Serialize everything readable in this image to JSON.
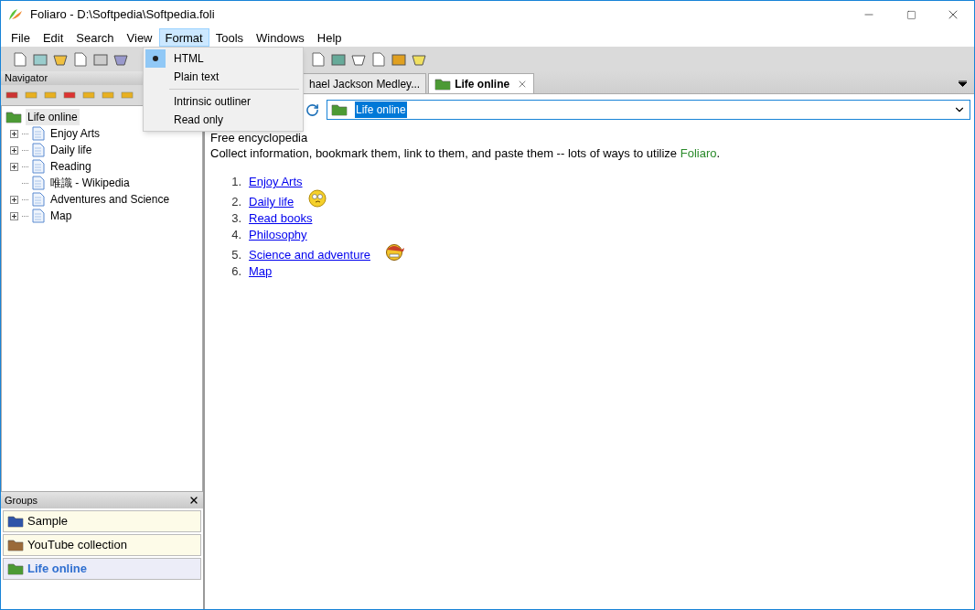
{
  "window": {
    "title": "Foliaro - D:\\Softpedia\\Softpedia.foli"
  },
  "menu_bar": [
    {
      "label": "File",
      "selected": false
    },
    {
      "label": "Edit",
      "selected": false
    },
    {
      "label": "Search",
      "selected": false
    },
    {
      "label": "View",
      "selected": false
    },
    {
      "label": "Format",
      "selected": true
    },
    {
      "label": "Tools",
      "selected": false
    },
    {
      "label": "Windows",
      "selected": false
    },
    {
      "label": "Help",
      "selected": false
    }
  ],
  "format_menu": [
    {
      "kind": "item",
      "label": "HTML",
      "checked": true,
      "selected": true
    },
    {
      "kind": "item",
      "label": "Plain text",
      "checked": false,
      "selected": false
    },
    {
      "kind": "separator"
    },
    {
      "kind": "item",
      "label": "Intrinsic outliner",
      "checked": false,
      "selected": false
    },
    {
      "kind": "item",
      "label": "Read only",
      "checked": false,
      "selected": false
    }
  ],
  "navigator": {
    "title": "Navigator",
    "tree": [
      {
        "label": "Life online",
        "selected": true,
        "children": [
          {
            "label": "Enjoy Arts",
            "expandable": true,
            "selected": false
          },
          {
            "label": "Daily life",
            "expandable": true,
            "selected": false
          },
          {
            "label": "Reading",
            "expandable": true,
            "selected": false
          },
          {
            "label": "唯識 - Wikipedia",
            "expandable": false,
            "selected": false
          },
          {
            "label": "Adventures and Science",
            "expandable": true,
            "selected": false
          },
          {
            "label": "Map",
            "expandable": true,
            "selected": false
          }
        ]
      }
    ]
  },
  "groups": {
    "title": "Groups",
    "items": [
      {
        "label": "Sample",
        "color": "#2f55a8",
        "selected": false
      },
      {
        "label": "YouTube collection",
        "color": "#9a6a3a",
        "selected": false
      },
      {
        "label": "Life online",
        "color": "#4c9a35",
        "selected": true
      }
    ]
  },
  "tabs": [
    {
      "label": "hael Jackson Medley...",
      "selected": false
    },
    {
      "label": "Life online",
      "selected": true
    }
  ],
  "address": {
    "value": "Life online"
  },
  "content": {
    "subtitle": "Free encyclopedia",
    "intro_before": "Collect information, bookmark them, link to them, and paste them -- lots of ways to utilize ",
    "intro_highlight": "Foliaro",
    "intro_after": ".",
    "links": [
      {
        "number": "1.",
        "label": "Enjoy Arts",
        "kind": "plain"
      },
      {
        "number": "2.",
        "label": "Daily life",
        "kind": "puzzled"
      },
      {
        "number": "3.",
        "label": "Read books",
        "kind": "plain"
      },
      {
        "number": "4.",
        "label": "Philosophy",
        "kind": "plain"
      },
      {
        "number": "5.",
        "label": "Science and adventure",
        "kind": "pirate"
      },
      {
        "number": "6.",
        "label": "Map",
        "kind": "plain"
      }
    ]
  }
}
